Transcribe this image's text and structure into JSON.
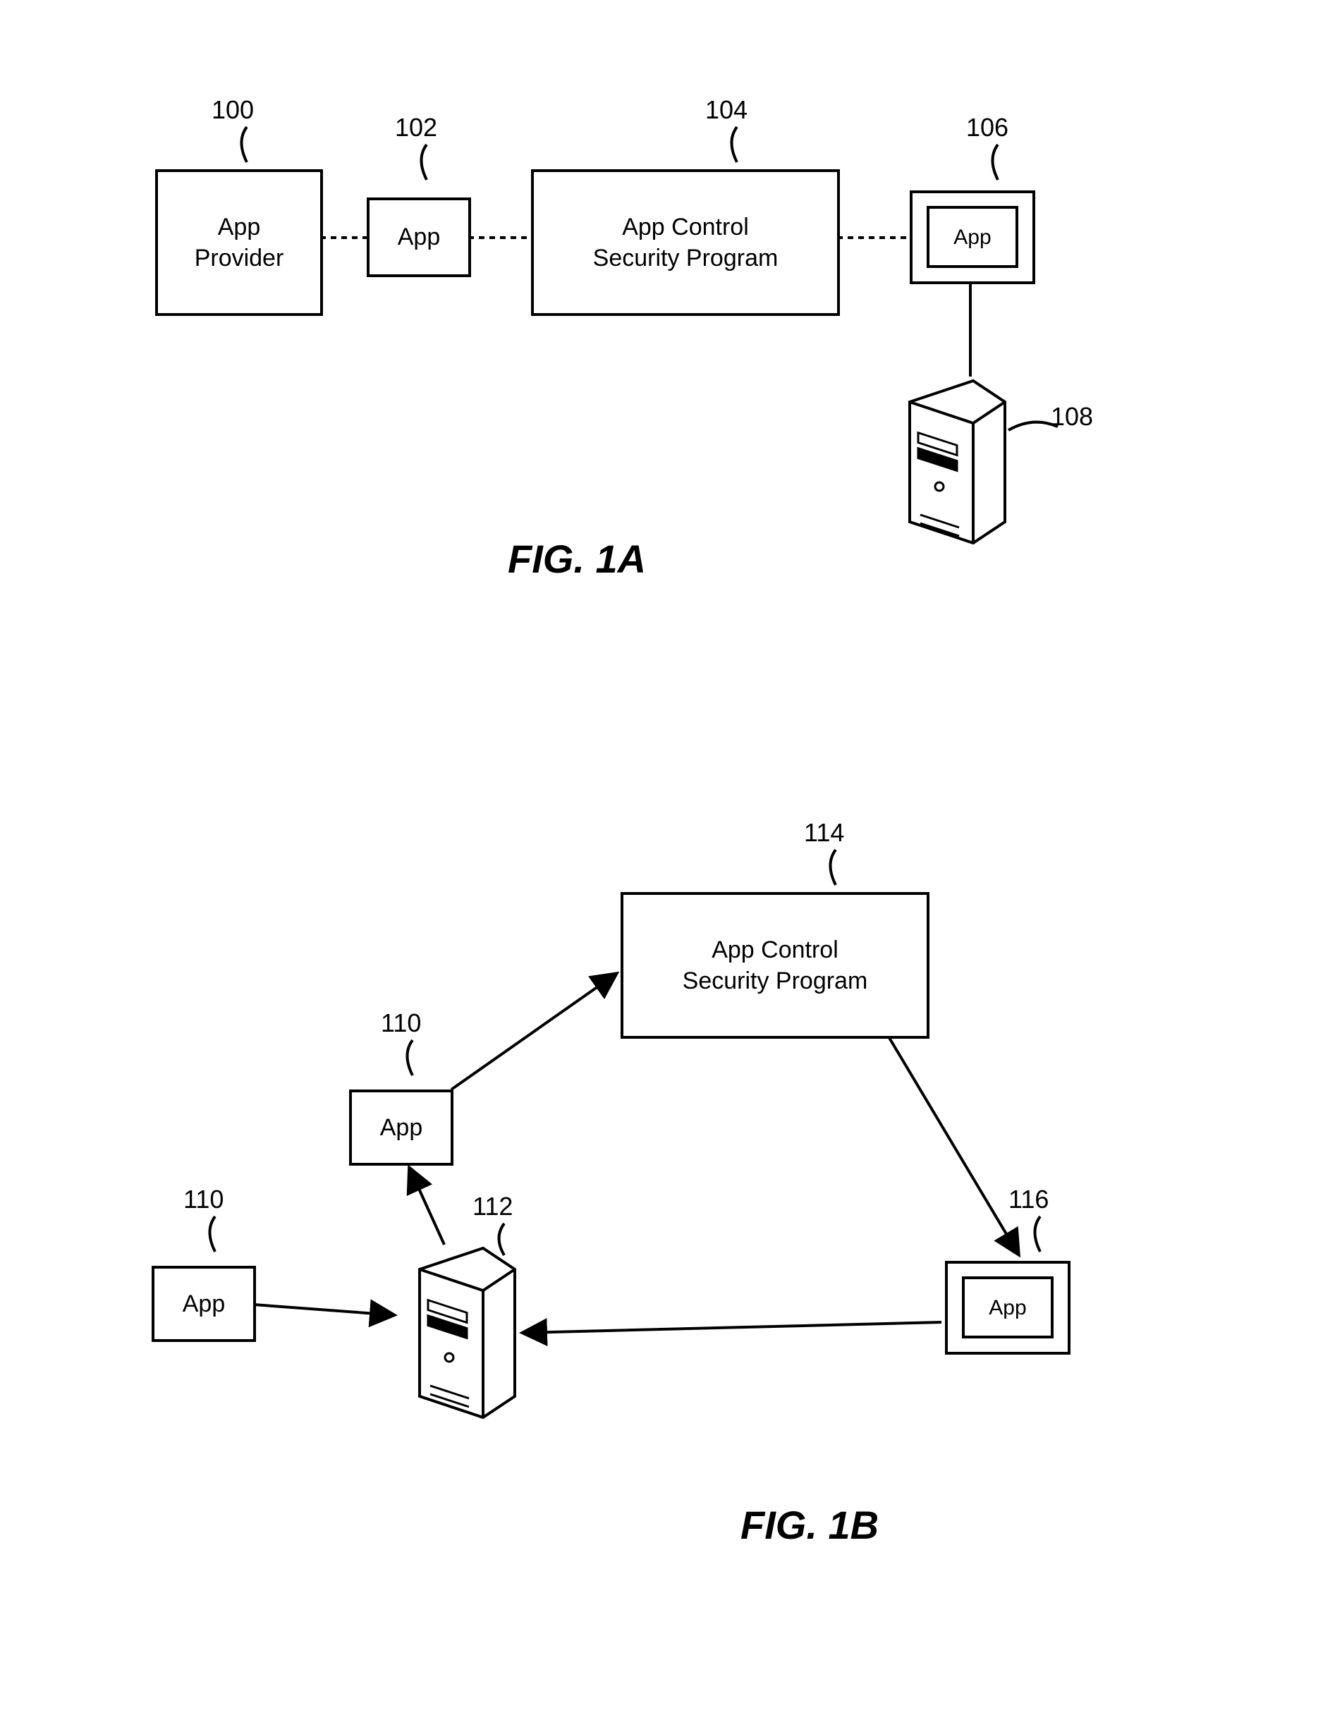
{
  "figA": {
    "title": "FIG. 1A",
    "refs": {
      "provider": "100",
      "app1": "102",
      "program": "104",
      "app2": "106",
      "server": "108"
    },
    "boxes": {
      "provider": "App\nProvider",
      "app1": "App",
      "program": "App Control\nSecurity Program",
      "app2": "App"
    }
  },
  "figB": {
    "title": "FIG. 1B",
    "refs": {
      "app1": "110",
      "app2": "110",
      "server": "112",
      "program": "114",
      "app3": "116"
    },
    "boxes": {
      "app1": "App",
      "app2": "App",
      "program": "App Control\nSecurity Program",
      "app3": "App"
    }
  }
}
